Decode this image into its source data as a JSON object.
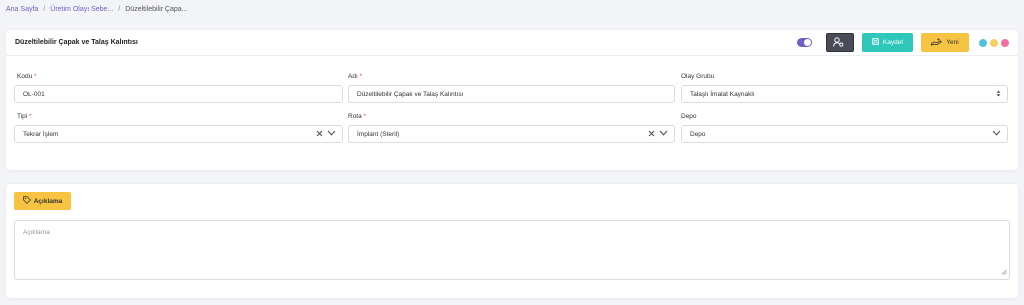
{
  "breadcrumb": {
    "home": "Ana Sayfa",
    "parent": "Üretim Olayı Sebe...",
    "current": "Düzeltilebilir Çapa..."
  },
  "header": {
    "title": "Düzeltilebilir Çapak ve Talaş Kalıntısı",
    "save_label": "Kaydet",
    "new_label": "Yeni",
    "toggle_on": true
  },
  "form": {
    "kodu": {
      "label": "Kodu",
      "required": "*",
      "value": "OL-001"
    },
    "adi": {
      "label": "Adı",
      "required": "*",
      "value": "Düzeltilebilir Çapak ve Talaş Kalıntısı"
    },
    "olay_grubu": {
      "label": "Olay Grubu",
      "value": "Talaşlı İmalat Kaynaklı"
    },
    "tipi": {
      "label": "Tipi",
      "required": "*",
      "value": "Tekrar İşlem"
    },
    "rota": {
      "label": "Rota",
      "required": "*",
      "value": "İmplant (Steril)"
    },
    "depo": {
      "label": "Depo",
      "value": "Depo"
    }
  },
  "description": {
    "button_label": "Açıklama",
    "placeholder": "Açıklama"
  },
  "colors": {
    "accent": "#6f61c4",
    "save": "#2ec7b9",
    "new": "#f7c342",
    "required": "#e3414f",
    "dots": [
      "#4ec5d6",
      "#f8cf62",
      "#ef6fa1"
    ]
  }
}
